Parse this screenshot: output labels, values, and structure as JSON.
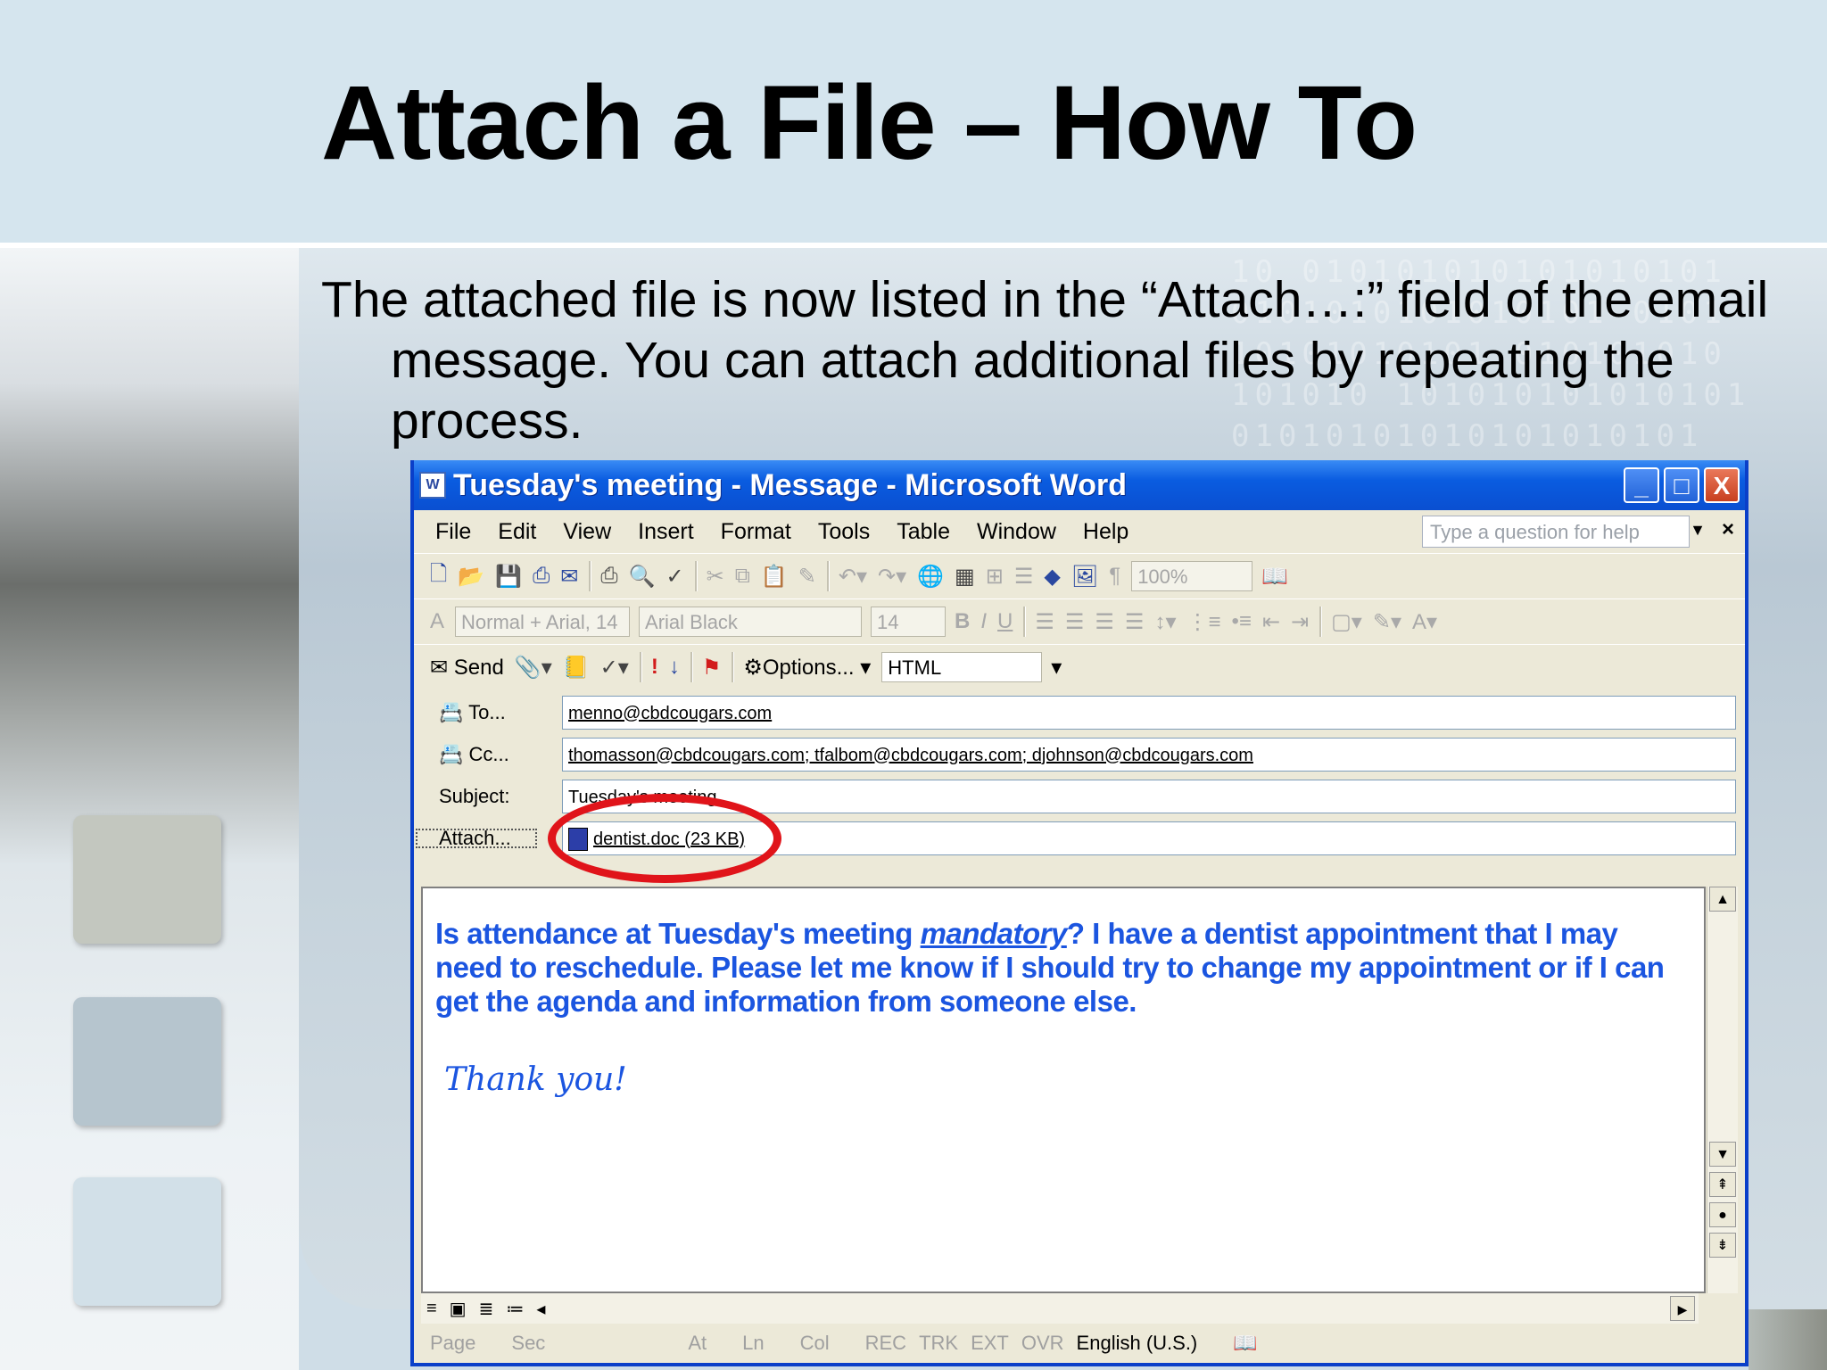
{
  "slide": {
    "title": "Attach a File – How To",
    "body": "The attached file is now listed in the “Attach…:” field of the email message.  You can attach additional files by repeating the process.",
    "background_binary": "10 010101010101010101\n0101010101010101 0101\n10101010101 010101010\n101010 101010101010101\n01010101010101010101"
  },
  "window": {
    "title": "Tuesday's meeting - Message - Microsoft Word",
    "controls": {
      "minimize": "_",
      "maximize": "□",
      "close": "X"
    },
    "menu": [
      "File",
      "Edit",
      "View",
      "Insert",
      "Format",
      "Tools",
      "Table",
      "Window",
      "Help"
    ],
    "help_placeholder": "Type a question for help",
    "zoom": "100%",
    "style_combo": "Normal + Arial, 14",
    "font_combo": "Arial Black",
    "size_combo": "14",
    "send_label": "Send",
    "options_label": "Options...",
    "format_combo": "HTML",
    "fields": {
      "to_label": "To...",
      "to_value": "menno@cbdcougars.com",
      "cc_label": "Cc...",
      "cc_value": "thomasson@cbdcougars.com; tfalbom@cbdcougars.com; djohnson@cbdcougars.com",
      "subject_label": "Subject:",
      "subject_value": "Tuesday's meeting",
      "attach_label": "Attach...",
      "attach_value": "dentist.doc (23 KB)"
    },
    "message": {
      "part1": "Is attendance at Tuesday's meeting ",
      "emphasis": "mandatory",
      "part2": "?  I have a dentist appointment that I may need to reschedule.  Please let me know if I should try to change my appointment or if I can get the agenda and information from someone else.",
      "signature": "Thank you!"
    },
    "status": {
      "page": "Page",
      "sec": "Sec",
      "at": "At",
      "ln": "Ln",
      "col": "Col",
      "rec": "REC",
      "trk": "TRK",
      "ext": "EXT",
      "ovr": "OVR",
      "language": "English (U.S.)"
    }
  },
  "colors": {
    "title_bar": "#0a4fd1",
    "message_text": "#1b55e0",
    "highlight_circle": "#e0141a"
  }
}
